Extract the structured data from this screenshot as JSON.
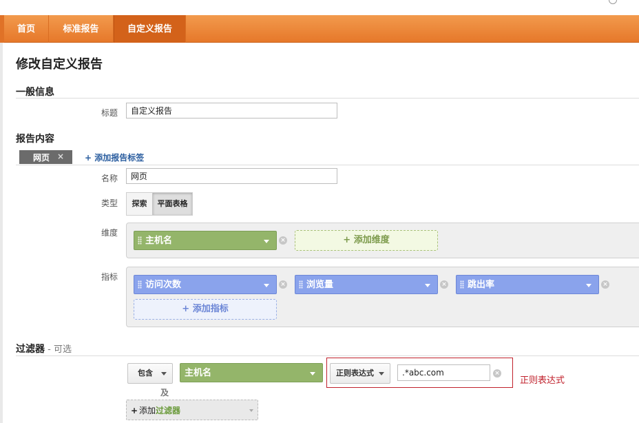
{
  "nav": {
    "tabs": [
      {
        "label": "首页"
      },
      {
        "label": "标准报告"
      },
      {
        "label": "自定义报告"
      }
    ],
    "active_color": "#d3621a",
    "bar_color": "#f29a4d"
  },
  "page": {
    "title": "修改自定义报告"
  },
  "general": {
    "heading": "一般信息",
    "title_label": "标题",
    "title_value": "自定义报告"
  },
  "content": {
    "heading": "报告内容",
    "tab_label": "网页",
    "tab_close": "×",
    "add_tab_link": "+ 添加报告标签",
    "name_label": "名称",
    "name_value": "网页",
    "type_label": "类型",
    "type_options": [
      "探索",
      "平面表格"
    ],
    "type_selected": "平面表格",
    "dimension_label": "维度",
    "dimensions": [
      "主机名"
    ],
    "add_dimension": "+ 添加维度",
    "metric_label": "指标",
    "metrics": [
      "访问次数",
      "浏览量",
      "跳出率"
    ],
    "add_metric": "+ 添加指标"
  },
  "filter": {
    "heading": "过滤器",
    "optional": " - 可选",
    "include_label": "包含",
    "dimension": "主机名",
    "match_type": "正则表达式",
    "value": ".*abc.com",
    "annotation": "正则表达式",
    "and_label": "及",
    "add_filter_prefix": "+",
    "add_filter_text": "添加",
    "add_filter_em": "过滤器"
  },
  "colors": {
    "dimension_pill": "#94b56a",
    "metric_pill": "#8aa3ec",
    "annotation_red": "#c0202b"
  }
}
